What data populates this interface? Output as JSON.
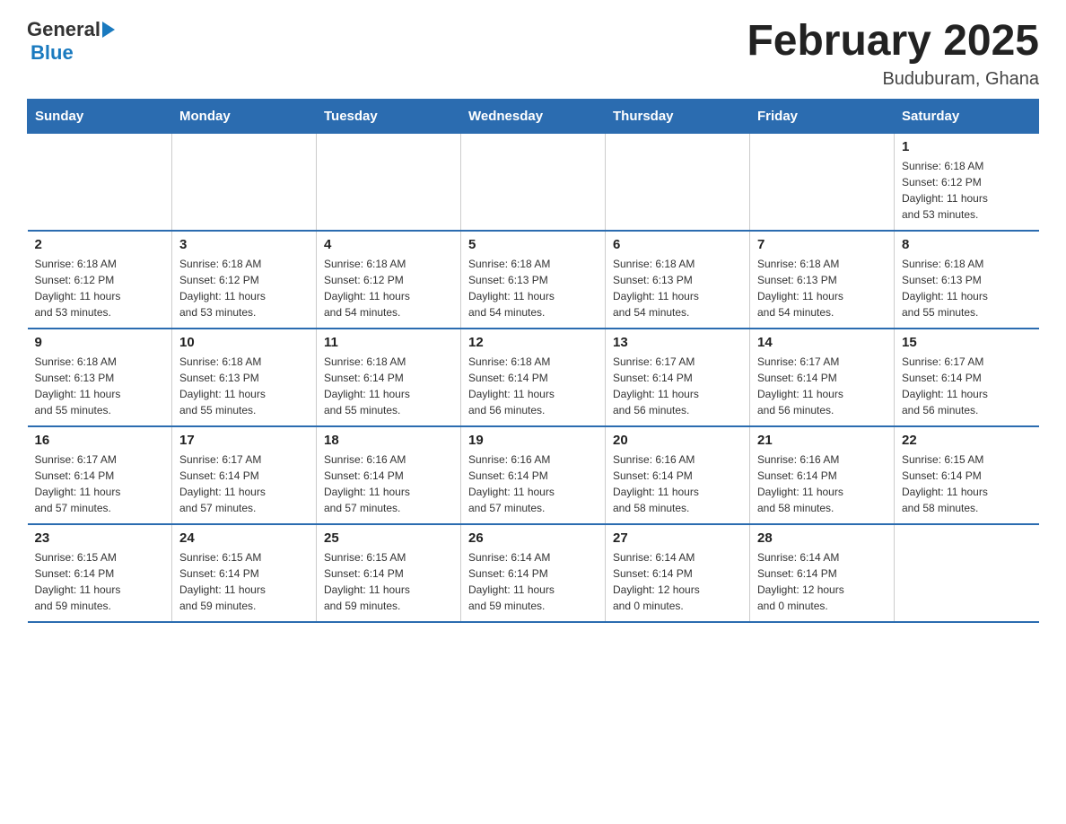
{
  "header": {
    "title": "February 2025",
    "location": "Buduburam, Ghana",
    "logo": {
      "general": "General",
      "blue": "Blue"
    }
  },
  "weekdays": [
    "Sunday",
    "Monday",
    "Tuesday",
    "Wednesday",
    "Thursday",
    "Friday",
    "Saturday"
  ],
  "weeks": [
    [
      {
        "day": "",
        "info": ""
      },
      {
        "day": "",
        "info": ""
      },
      {
        "day": "",
        "info": ""
      },
      {
        "day": "",
        "info": ""
      },
      {
        "day": "",
        "info": ""
      },
      {
        "day": "",
        "info": ""
      },
      {
        "day": "1",
        "info": "Sunrise: 6:18 AM\nSunset: 6:12 PM\nDaylight: 11 hours\nand 53 minutes."
      }
    ],
    [
      {
        "day": "2",
        "info": "Sunrise: 6:18 AM\nSunset: 6:12 PM\nDaylight: 11 hours\nand 53 minutes."
      },
      {
        "day": "3",
        "info": "Sunrise: 6:18 AM\nSunset: 6:12 PM\nDaylight: 11 hours\nand 53 minutes."
      },
      {
        "day": "4",
        "info": "Sunrise: 6:18 AM\nSunset: 6:12 PM\nDaylight: 11 hours\nand 54 minutes."
      },
      {
        "day": "5",
        "info": "Sunrise: 6:18 AM\nSunset: 6:13 PM\nDaylight: 11 hours\nand 54 minutes."
      },
      {
        "day": "6",
        "info": "Sunrise: 6:18 AM\nSunset: 6:13 PM\nDaylight: 11 hours\nand 54 minutes."
      },
      {
        "day": "7",
        "info": "Sunrise: 6:18 AM\nSunset: 6:13 PM\nDaylight: 11 hours\nand 54 minutes."
      },
      {
        "day": "8",
        "info": "Sunrise: 6:18 AM\nSunset: 6:13 PM\nDaylight: 11 hours\nand 55 minutes."
      }
    ],
    [
      {
        "day": "9",
        "info": "Sunrise: 6:18 AM\nSunset: 6:13 PM\nDaylight: 11 hours\nand 55 minutes."
      },
      {
        "day": "10",
        "info": "Sunrise: 6:18 AM\nSunset: 6:13 PM\nDaylight: 11 hours\nand 55 minutes."
      },
      {
        "day": "11",
        "info": "Sunrise: 6:18 AM\nSunset: 6:14 PM\nDaylight: 11 hours\nand 55 minutes."
      },
      {
        "day": "12",
        "info": "Sunrise: 6:18 AM\nSunset: 6:14 PM\nDaylight: 11 hours\nand 56 minutes."
      },
      {
        "day": "13",
        "info": "Sunrise: 6:17 AM\nSunset: 6:14 PM\nDaylight: 11 hours\nand 56 minutes."
      },
      {
        "day": "14",
        "info": "Sunrise: 6:17 AM\nSunset: 6:14 PM\nDaylight: 11 hours\nand 56 minutes."
      },
      {
        "day": "15",
        "info": "Sunrise: 6:17 AM\nSunset: 6:14 PM\nDaylight: 11 hours\nand 56 minutes."
      }
    ],
    [
      {
        "day": "16",
        "info": "Sunrise: 6:17 AM\nSunset: 6:14 PM\nDaylight: 11 hours\nand 57 minutes."
      },
      {
        "day": "17",
        "info": "Sunrise: 6:17 AM\nSunset: 6:14 PM\nDaylight: 11 hours\nand 57 minutes."
      },
      {
        "day": "18",
        "info": "Sunrise: 6:16 AM\nSunset: 6:14 PM\nDaylight: 11 hours\nand 57 minutes."
      },
      {
        "day": "19",
        "info": "Sunrise: 6:16 AM\nSunset: 6:14 PM\nDaylight: 11 hours\nand 57 minutes."
      },
      {
        "day": "20",
        "info": "Sunrise: 6:16 AM\nSunset: 6:14 PM\nDaylight: 11 hours\nand 58 minutes."
      },
      {
        "day": "21",
        "info": "Sunrise: 6:16 AM\nSunset: 6:14 PM\nDaylight: 11 hours\nand 58 minutes."
      },
      {
        "day": "22",
        "info": "Sunrise: 6:15 AM\nSunset: 6:14 PM\nDaylight: 11 hours\nand 58 minutes."
      }
    ],
    [
      {
        "day": "23",
        "info": "Sunrise: 6:15 AM\nSunset: 6:14 PM\nDaylight: 11 hours\nand 59 minutes."
      },
      {
        "day": "24",
        "info": "Sunrise: 6:15 AM\nSunset: 6:14 PM\nDaylight: 11 hours\nand 59 minutes."
      },
      {
        "day": "25",
        "info": "Sunrise: 6:15 AM\nSunset: 6:14 PM\nDaylight: 11 hours\nand 59 minutes."
      },
      {
        "day": "26",
        "info": "Sunrise: 6:14 AM\nSunset: 6:14 PM\nDaylight: 11 hours\nand 59 minutes."
      },
      {
        "day": "27",
        "info": "Sunrise: 6:14 AM\nSunset: 6:14 PM\nDaylight: 12 hours\nand 0 minutes."
      },
      {
        "day": "28",
        "info": "Sunrise: 6:14 AM\nSunset: 6:14 PM\nDaylight: 12 hours\nand 0 minutes."
      },
      {
        "day": "",
        "info": ""
      }
    ]
  ]
}
